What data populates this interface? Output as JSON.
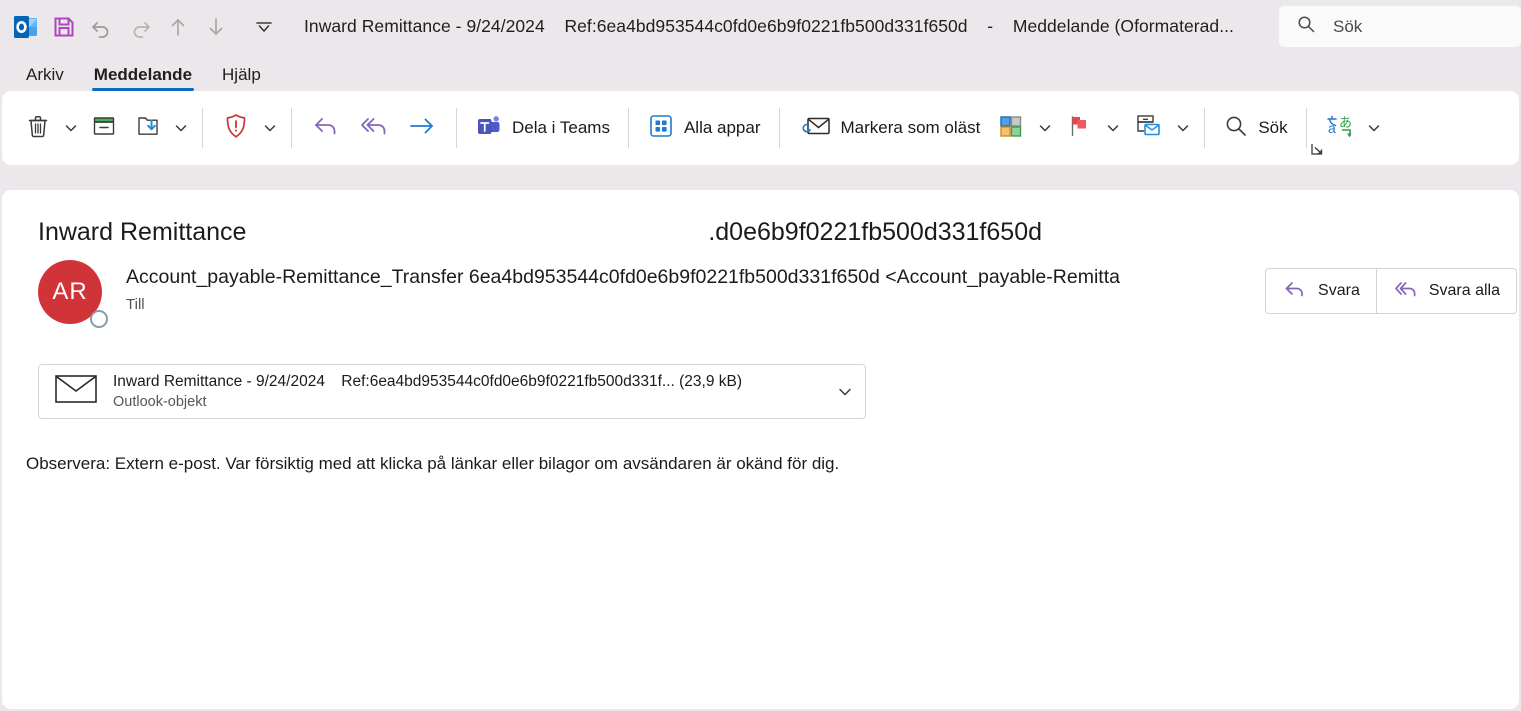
{
  "window": {
    "title_subject": "Inward Remittance - 9/24/2024",
    "title_ref": "Ref:6ea4bd953544c0fd0e6b9f0221fb500d331f650d",
    "title_dash": "-",
    "title_type": "Meddelande (Oformaterad...",
    "app_icon": "outlook-icon"
  },
  "quick_access": [
    {
      "name": "save-icon",
      "title": "Spara"
    },
    {
      "name": "undo-icon",
      "title": "Ångra"
    },
    {
      "name": "redo-icon",
      "title": "Gör om"
    },
    {
      "name": "previous-item-icon",
      "title": "Föregående objekt"
    },
    {
      "name": "next-item-icon",
      "title": "Nästa objekt"
    },
    {
      "name": "customize-quick-access-icon",
      "title": "Anpassa verktygsfältet Snabbåtkomst"
    }
  ],
  "search": {
    "placeholder": "Sök",
    "icon": "search-icon"
  },
  "tabs": [
    {
      "label": "Arkiv",
      "active": false
    },
    {
      "label": "Meddelande",
      "active": true
    },
    {
      "label": "Hjälp",
      "active": false
    }
  ],
  "ribbon": {
    "delete_label": "Ta bort",
    "archive_label": "Arkivera",
    "move_label": "Flytta",
    "junk_label": "Skräppost",
    "reply_label": "Svara",
    "reply_all_label": "Svara alla",
    "forward_label": "Vidarebefordra",
    "teams_label": "Dela i Teams",
    "apps_label": "Alla appar",
    "unread_label": "Markera som oläst",
    "categorize_label": "Kategorisera",
    "followup_label": "Uppföljning",
    "rules_label": "Regler",
    "search_label": "Sök",
    "translate_label": "Översätt",
    "dialog_launcher_label": "Fler alternativ"
  },
  "message": {
    "subject_head": "Inward Remittance",
    "subject_tail": ".d0e6b9f0221fb500d331f650d",
    "avatar_initials": "AR",
    "sender": "Account_payable-Remittance_Transfer 6ea4bd953544c0fd0e6b9f0221fb500d331f650d <Account_payable-Remitta",
    "to_label": "Till",
    "reply_button": "Svara",
    "reply_all_button": "Svara alla",
    "attachment": {
      "name": "Inward Remittance - 9/24/2024",
      "ref": "Ref:6ea4bd953544c0fd0e6b9f0221fb500d331f...",
      "size": "(23,9 kB)",
      "type": "Outlook-objekt",
      "icon": "envelope-icon"
    },
    "body_warning": "Observera: Extern e-post. Var försiktig med att klicka på länkar eller bilagor om avsändaren är okänd för dig."
  },
  "colors": {
    "window_bg": "#ece7ea",
    "pane_bg": "#ffffff",
    "accent": "#0f6cbd",
    "avatar": "#d13438",
    "reply_purple": "#8764b8",
    "forward_blue": "#0f6cbd",
    "junk_red": "#d13438"
  }
}
